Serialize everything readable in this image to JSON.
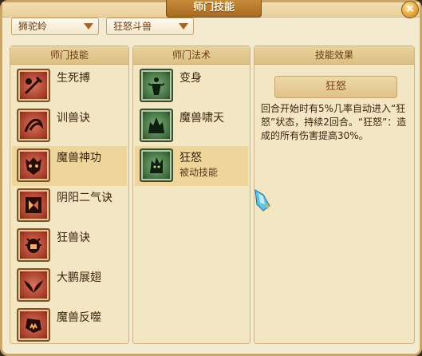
{
  "window": {
    "title": "师门技能",
    "close_label": "×"
  },
  "filters": {
    "sect": "狮驼岭",
    "skill_group": "狂怒斗兽"
  },
  "panels": {
    "sect_skills": {
      "header": "师门技能",
      "items": [
        {
          "name": "生死搏",
          "icon": "sword-slash-icon"
        },
        {
          "name": "训兽诀",
          "icon": "whip-icon"
        },
        {
          "name": "魔兽神功",
          "icon": "beast-mask-icon",
          "selected": true
        },
        {
          "name": "阴阳二气诀",
          "icon": "yin-yang-mask-icon"
        },
        {
          "name": "狂兽诀",
          "icon": "beetle-beast-icon"
        },
        {
          "name": "大鹏展翅",
          "icon": "wings-icon"
        },
        {
          "name": "魔兽反噬",
          "icon": "beast-bite-icon"
        }
      ]
    },
    "sect_spells": {
      "header": "师门法术",
      "items": [
        {
          "name": "变身",
          "subtitle": "",
          "icon": "transform-icon"
        },
        {
          "name": "魔兽啸天",
          "subtitle": "",
          "icon": "roar-icon"
        },
        {
          "name": "狂怒",
          "subtitle": "被动技能",
          "icon": "rage-beast-icon",
          "selected": true
        }
      ]
    },
    "effect": {
      "header": "技能效果",
      "skill_name": "狂怒",
      "description": "回合开始时有5%几率自动进入“狂怒”状态，持续2回合。“狂怒”：造成的所有伤害提高30%。"
    }
  }
}
